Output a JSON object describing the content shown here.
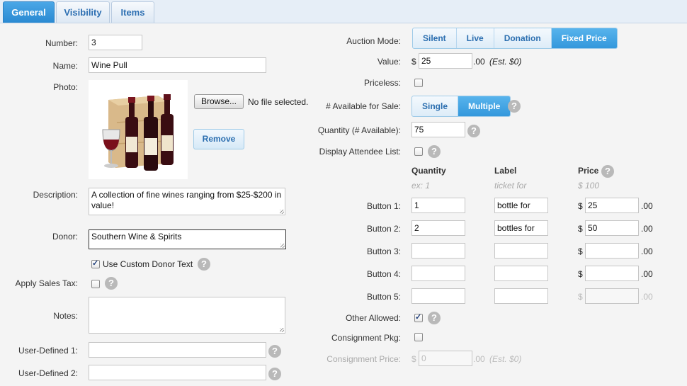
{
  "tabs": [
    {
      "label": "General",
      "active": true
    },
    {
      "label": "Visibility",
      "active": false
    },
    {
      "label": "Items",
      "active": false
    }
  ],
  "left": {
    "number_label": "Number:",
    "number_value": "3",
    "name_label": "Name:",
    "name_value": "Wine Pull",
    "photo_label": "Photo:",
    "browse_label": "Browse...",
    "file_status": "No file selected.",
    "remove_label": "Remove",
    "description_label": "Description:",
    "description_value": "A collection of fine wines ranging from $25-$200 in value!",
    "donor_label": "Donor:",
    "donor_value": "Southern Wine & Spirits",
    "custom_donor_label": "Use Custom Donor Text",
    "sales_tax_label": "Apply Sales Tax:",
    "notes_label": "Notes:",
    "notes_value": "",
    "ud1_label": "User-Defined 1:",
    "ud1_value": "",
    "ud2_label": "User-Defined 2:",
    "ud2_value": ""
  },
  "right": {
    "auction_mode_label": "Auction Mode:",
    "auction_modes": [
      {
        "label": "Silent",
        "selected": false
      },
      {
        "label": "Live",
        "selected": false
      },
      {
        "label": "Donation",
        "selected": false
      },
      {
        "label": "Fixed Price",
        "selected": true
      }
    ],
    "value_label": "Value:",
    "currency": "$",
    "value_amount": "25",
    "cents": ".00",
    "value_est": "(Est. $0)",
    "priceless_label": "Priceless:",
    "available_label": "# Available for Sale:",
    "available_options": [
      {
        "label": "Single",
        "selected": false
      },
      {
        "label": "Multiple",
        "selected": true
      }
    ],
    "quantity_label": "Quantity (# Available):",
    "quantity_value": "75",
    "attendee_label": "Display Attendee List:",
    "col_quantity": "Quantity",
    "col_label": "Label",
    "col_price": "Price",
    "hint_quantity": "ex: 1",
    "hint_label": "ticket for",
    "hint_price": "$ 100",
    "buttons": [
      {
        "name": "Button 1:",
        "quantity": "1",
        "label": "bottle for",
        "price": "25"
      },
      {
        "name": "Button 2:",
        "quantity": "2",
        "label": "bottles for",
        "price": "50"
      },
      {
        "name": "Button 3:",
        "quantity": "",
        "label": "",
        "price": ""
      },
      {
        "name": "Button 4:",
        "quantity": "",
        "label": "",
        "price": ""
      },
      {
        "name": "Button 5:",
        "quantity": "",
        "label": "",
        "price": ""
      }
    ],
    "other_allowed_label": "Other Allowed:",
    "consignment_pkg_label": "Consignment Pkg:",
    "consignment_price_label": "Consignment Price:",
    "consignment_price_value": "0",
    "consignment_est": "(Est. $0)",
    "help_glyph": "?"
  },
  "colors": {
    "accent": "#3398dc",
    "tab_text": "#2d6fb2",
    "help": "#b9b9b9"
  }
}
